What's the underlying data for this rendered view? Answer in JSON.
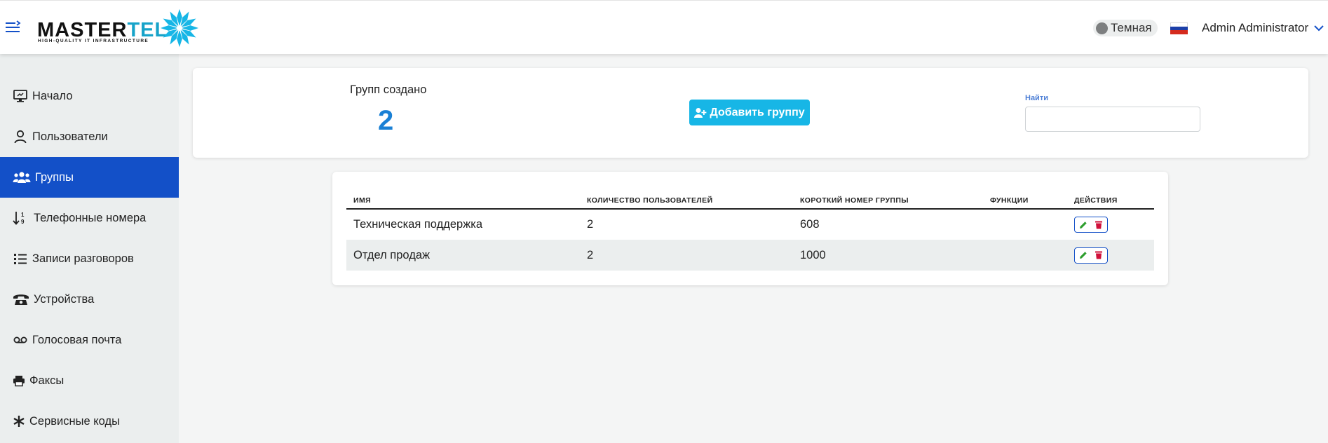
{
  "header": {
    "brand": {
      "word_main": "MASTER",
      "word_accent": "TEL",
      "tagline": "HIGH-QUALITY IT INFRASTRUCTURE"
    },
    "theme_toggle_label": "Темная",
    "language_flag": "russia-flag-icon",
    "user_name": "Admin Administrator"
  },
  "sidebar": {
    "items": [
      {
        "label": "Начало",
        "icon": "monitor-icon",
        "active": false
      },
      {
        "label": "Пользователи",
        "icon": "user-icon",
        "active": false
      },
      {
        "label": "Группы",
        "icon": "users-group-icon",
        "active": true
      },
      {
        "label": "Телефонные номера",
        "icon": "sort-numeric-icon",
        "active": false
      },
      {
        "label": "Записи разговоров",
        "icon": "list-icon",
        "active": false
      },
      {
        "label": "Устройства",
        "icon": "telephone-icon",
        "active": false
      },
      {
        "label": "Голосовая почта",
        "icon": "voicemail-icon",
        "active": false
      },
      {
        "label": "Факсы",
        "icon": "printer-icon",
        "active": false
      },
      {
        "label": "Сервисные коды",
        "icon": "asterisk-icon",
        "active": false
      }
    ]
  },
  "stats": {
    "label": "Групп создано",
    "value": "2",
    "add_button_label": "Добавить группу",
    "search_label": "Найти",
    "search_value": ""
  },
  "table": {
    "columns": [
      "Имя",
      "Количество пользователей",
      "Короткий номер группы",
      "Функции",
      "Действия"
    ],
    "rows": [
      {
        "name": "Техническая поддержка",
        "user_count": "2",
        "short_number": "608",
        "functions": ""
      },
      {
        "name": "Отдел продаж",
        "user_count": "2",
        "short_number": "1000",
        "functions": ""
      }
    ]
  },
  "colors": {
    "accent": "#1350c8",
    "brand_teal": "#17a3c9",
    "add_button": "#17b6e6",
    "stat_value": "#1a80d5",
    "edit": "#2e9e2e",
    "delete": "#d0103a"
  }
}
